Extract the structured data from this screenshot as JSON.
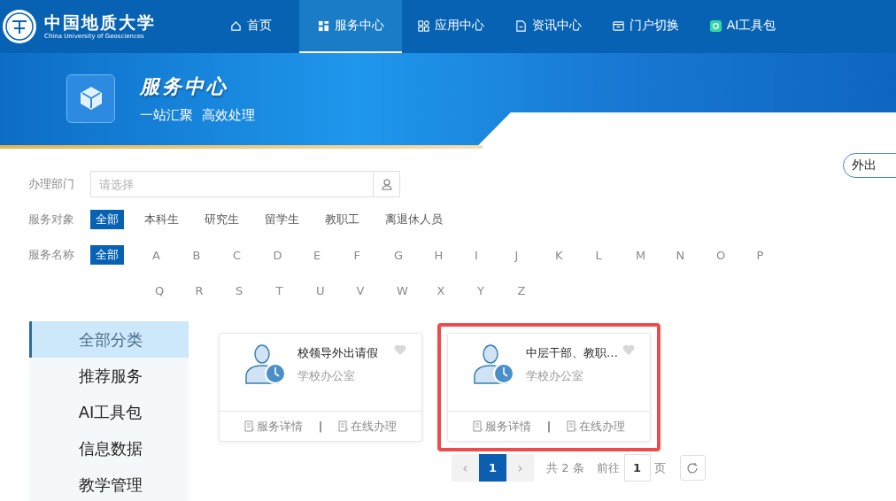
{
  "header": {
    "logo": {
      "name": "中国地质大学",
      "subtitle": "China University of Geosciences"
    },
    "nav": [
      {
        "label": "首页",
        "kind": "home",
        "selected": false
      },
      {
        "label": "服务中心",
        "kind": "grid",
        "selected": true
      },
      {
        "label": "应用中心",
        "kind": "apps",
        "selected": false
      },
      {
        "label": "资讯中心",
        "kind": "doc",
        "selected": false
      },
      {
        "label": "门户切换",
        "kind": "portal",
        "selected": false
      },
      {
        "label": "AI工具包",
        "kind": "ai",
        "selected": false
      }
    ]
  },
  "banner": {
    "title": "服务中心",
    "subtitle": "一站汇聚  高效处理"
  },
  "filters": {
    "department": {
      "label": "办理部门",
      "placeholder": "请选择"
    },
    "search": {
      "value": "外出"
    },
    "audience": {
      "label": "服务对象",
      "options": [
        {
          "label": "全部",
          "selected": true
        },
        {
          "label": "本科生",
          "selected": false
        },
        {
          "label": "研究生",
          "selected": false
        },
        {
          "label": "留学生",
          "selected": false
        },
        {
          "label": "教职工",
          "selected": false
        },
        {
          "label": "离退休人员",
          "selected": false
        }
      ]
    },
    "name": {
      "label": "服务名称",
      "options": [
        {
          "label": "全部",
          "selected": true
        },
        {
          "label": "A",
          "selected": false
        },
        {
          "label": "B",
          "selected": false
        },
        {
          "label": "C",
          "selected": false
        },
        {
          "label": "D",
          "selected": false
        },
        {
          "label": "E",
          "selected": false
        },
        {
          "label": "F",
          "selected": false
        },
        {
          "label": "G",
          "selected": false
        },
        {
          "label": "H",
          "selected": false
        },
        {
          "label": "I",
          "selected": false
        },
        {
          "label": "J",
          "selected": false
        },
        {
          "label": "K",
          "selected": false
        },
        {
          "label": "L",
          "selected": false
        },
        {
          "label": "M",
          "selected": false
        },
        {
          "label": "N",
          "selected": false
        },
        {
          "label": "O",
          "selected": false
        },
        {
          "label": "P",
          "selected": false
        },
        {
          "label": "Q",
          "selected": false
        },
        {
          "label": "R",
          "selected": false
        },
        {
          "label": "S",
          "selected": false
        },
        {
          "label": "T",
          "selected": false
        },
        {
          "label": "U",
          "selected": false
        },
        {
          "label": "V",
          "selected": false
        },
        {
          "label": "W",
          "selected": false
        },
        {
          "label": "X",
          "selected": false
        },
        {
          "label": "Y",
          "selected": false
        },
        {
          "label": "Z",
          "selected": false
        }
      ]
    }
  },
  "sidebar": {
    "items": [
      {
        "label": "全部分类",
        "selected": true
      },
      {
        "label": "推荐服务",
        "selected": false
      },
      {
        "label": "AI工具包",
        "selected": false
      },
      {
        "label": "信息数据",
        "selected": false
      },
      {
        "label": "教学管理",
        "selected": false
      }
    ]
  },
  "cards": [
    {
      "title": "校领导外出请假",
      "department": "学校办公室",
      "favorite": false,
      "highlighted": false,
      "actions": [
        "服务详情",
        "在线办理"
      ],
      "separator": "|"
    },
    {
      "title": "中层干部、教职…",
      "department": "学校办公室",
      "favorite": false,
      "highlighted": true,
      "actions": [
        "服务详情",
        "在线办理"
      ],
      "separator": "|"
    }
  ],
  "pagination": {
    "prev": "‹",
    "next": "›",
    "pages": [
      {
        "label": "1",
        "selected": true
      }
    ],
    "total": "共 2 条",
    "goto_label": "前往",
    "goto_value": "1",
    "page_unit": "页"
  }
}
